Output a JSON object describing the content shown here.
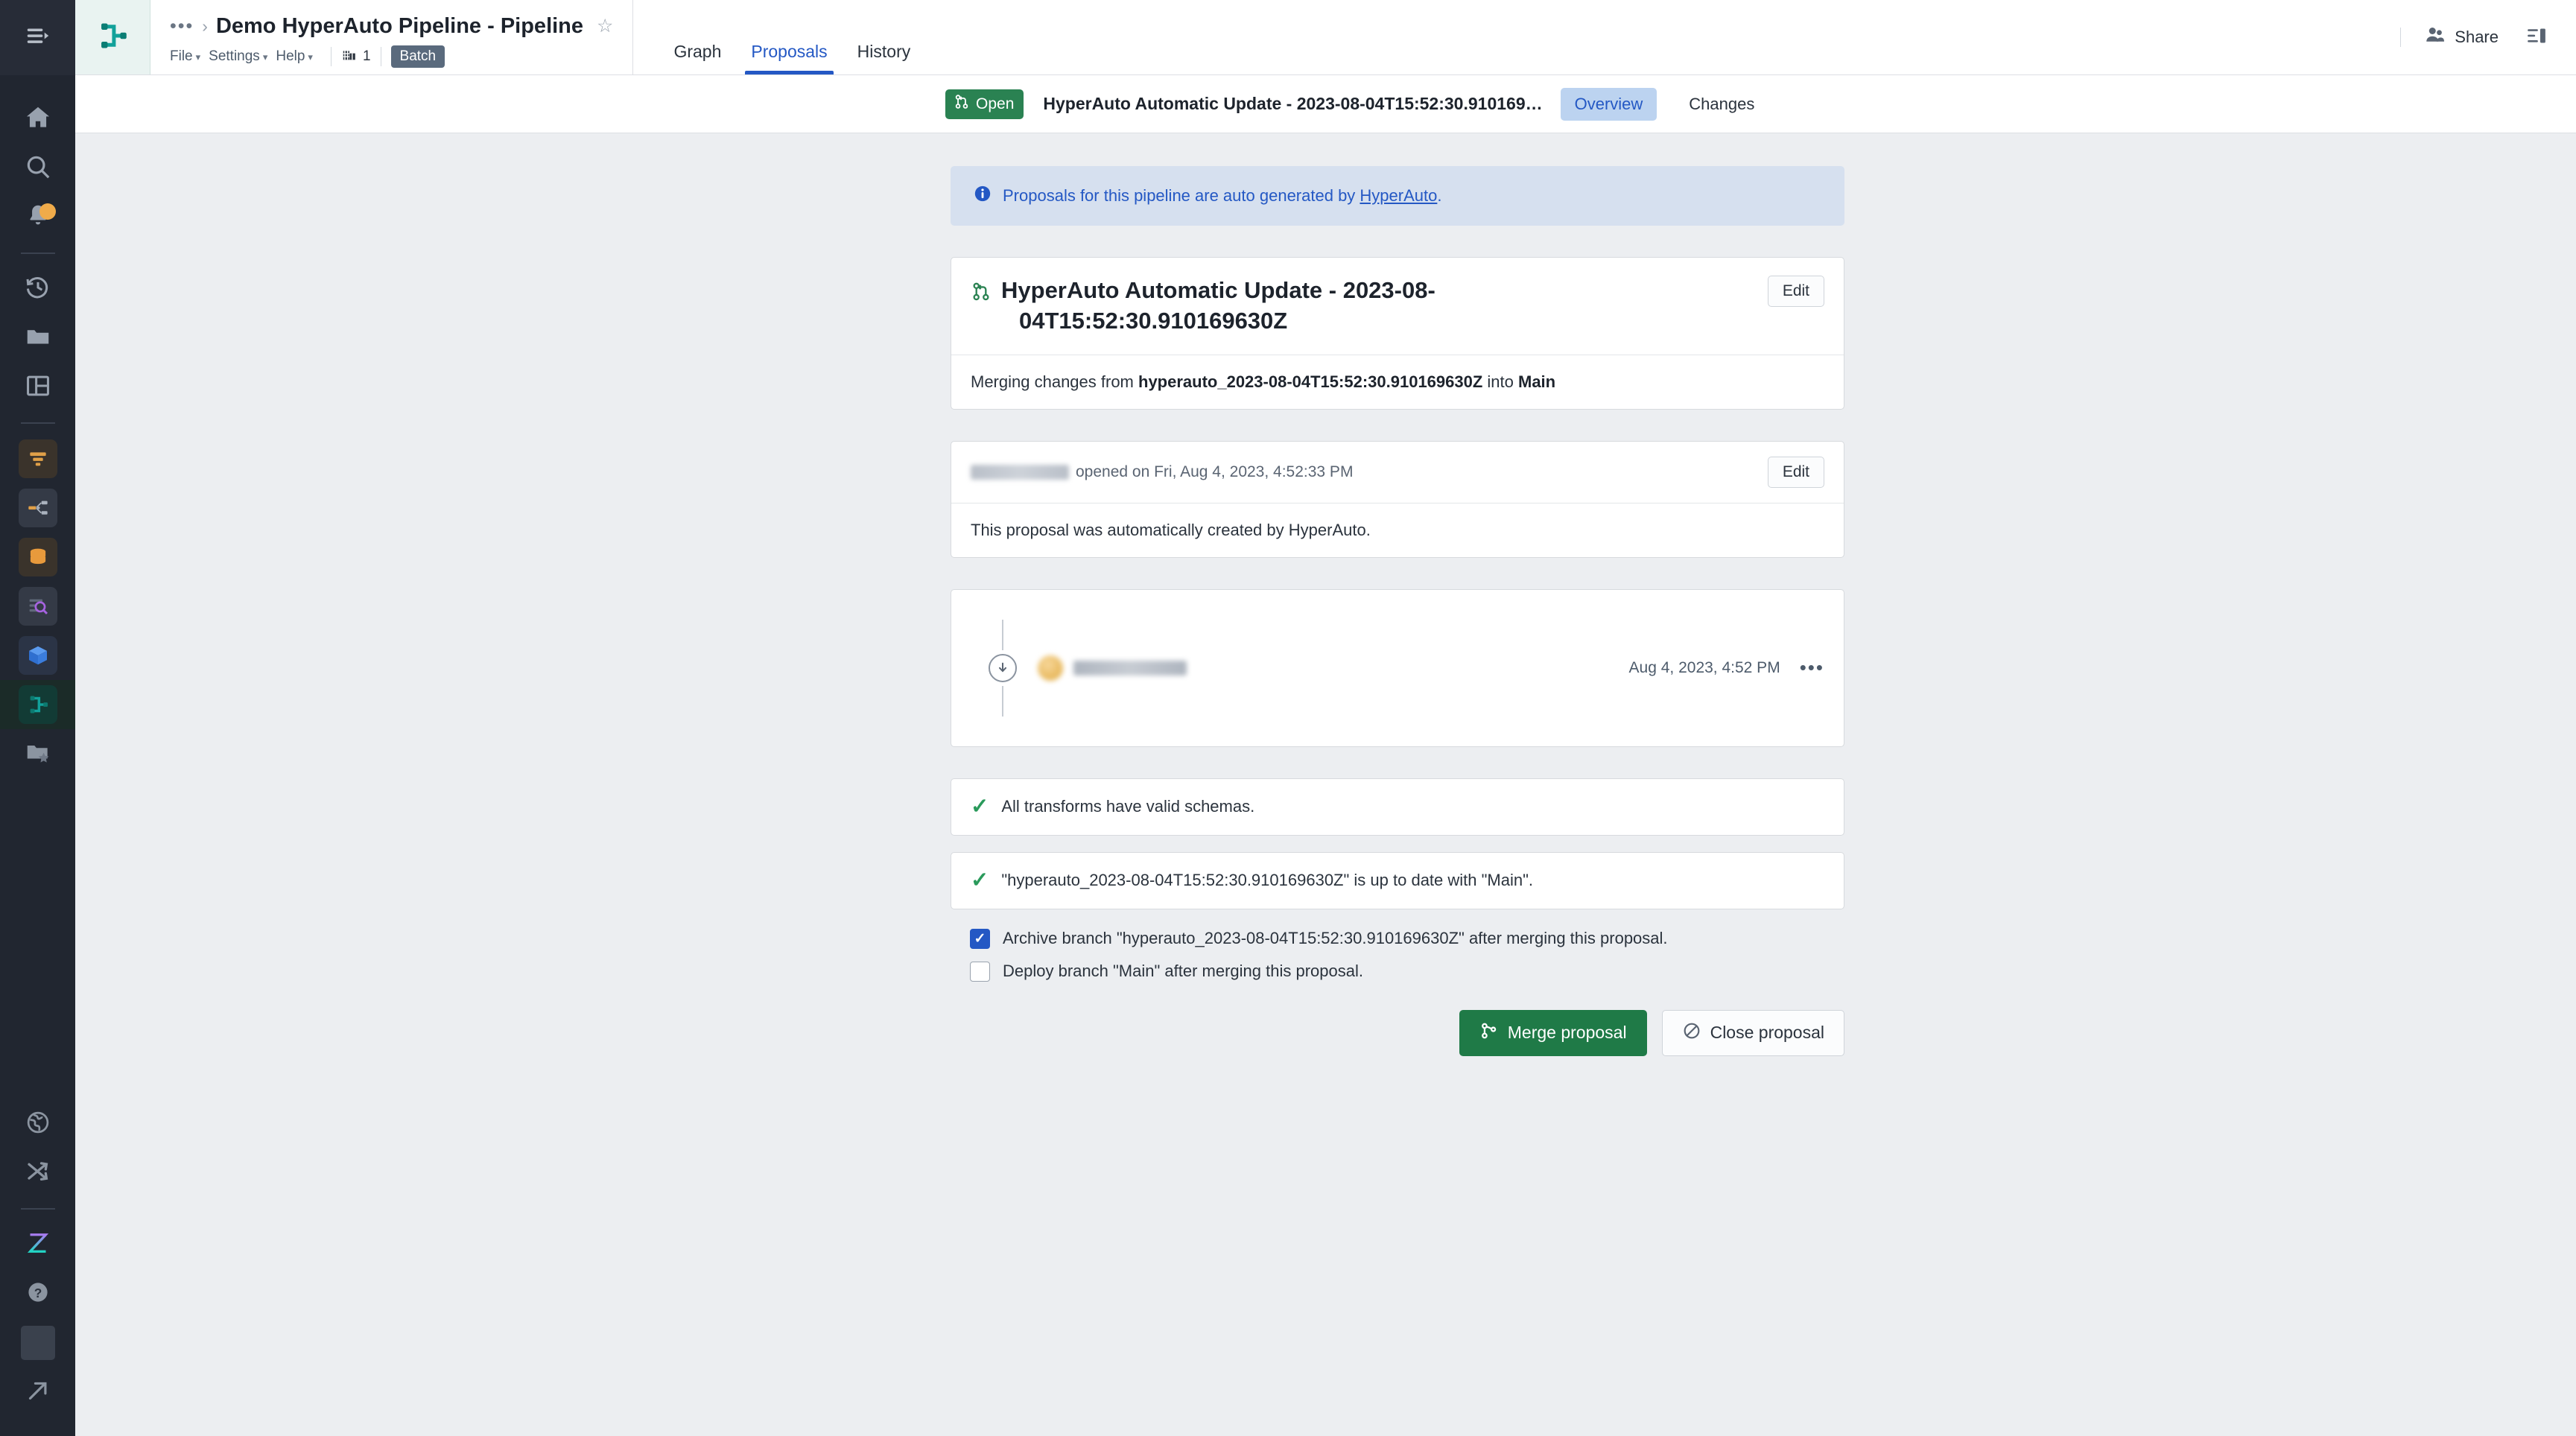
{
  "colors": {
    "rail_bg": "#212630",
    "accent_blue": "#2458c4",
    "open_green": "#2a8252",
    "merge_green": "#1f7a47",
    "check_green": "#2a9a5b",
    "banner_bg": "#d6e0ef",
    "seg_active_bg": "#bcd3f0",
    "batch_tag_bg": "#5a6a7d",
    "notification_dot": "#f0ab4a",
    "app_bg": "#eceef1"
  },
  "rail": {
    "toggle": {
      "name": "expand-sidebar-toggle",
      "icon": "hamburger-expand-icon"
    },
    "items_top": [
      {
        "icon": "home-icon",
        "name": "rail-home"
      },
      {
        "icon": "search-icon",
        "name": "rail-search"
      },
      {
        "icon": "bell-icon",
        "name": "rail-notifications",
        "badge": true
      }
    ],
    "items_files": [
      {
        "icon": "history-clock-icon",
        "name": "rail-recent"
      },
      {
        "icon": "folder-icon",
        "name": "rail-projects"
      },
      {
        "icon": "layout-panel-icon",
        "name": "rail-workspace"
      }
    ],
    "items_apps": [
      {
        "icon": "filter-funnel-icon",
        "name": "rail-app-contour",
        "color": "#e0a048"
      },
      {
        "icon": "graph-nodes-icon",
        "name": "rail-app-graph",
        "color": "#e0a048"
      },
      {
        "icon": "database-icon",
        "name": "rail-app-datasets",
        "color": "#e89a3c"
      },
      {
        "icon": "data-search-icon",
        "name": "rail-app-quiver",
        "color": "#a663e0"
      },
      {
        "icon": "cube-icon",
        "name": "rail-app-ontology",
        "color": "#3b7ddd"
      },
      {
        "icon": "pipeline-icon",
        "name": "rail-app-pipeline-builder",
        "color": "#12a19a",
        "active": true
      },
      {
        "icon": "folder-star-icon",
        "name": "rail-app-favorites",
        "color": "#8b94a0"
      }
    ],
    "items_bottom": [
      {
        "icon": "globe-icon",
        "name": "rail-globe"
      },
      {
        "icon": "shuffle-icon",
        "name": "rail-shuffle"
      },
      {
        "icon": "hourglass-gradient-icon",
        "name": "rail-aip"
      },
      {
        "icon": "help-circle-icon",
        "name": "rail-help"
      },
      {
        "icon": "user-avatar-icon",
        "name": "rail-account"
      },
      {
        "icon": "external-link-arrow-icon",
        "name": "rail-open-external"
      }
    ]
  },
  "header": {
    "logo_icon": "pipeline-builder-logo",
    "breadcrumb_dots": "•••",
    "breadcrumb_sep": "›",
    "title": "Demo HyperAuto Pipeline - Pipeline",
    "star_icon": "☆",
    "menus": [
      {
        "label": "File",
        "caret": "▾"
      },
      {
        "label": "Settings",
        "caret": "▾"
      },
      {
        "label": "Help",
        "caret": "▾"
      }
    ],
    "org_count": "1",
    "org_icon": "organization-icon",
    "batch_tag": "Batch",
    "tabs": [
      {
        "label": "Graph",
        "active": false
      },
      {
        "label": "Proposals",
        "active": true
      },
      {
        "label": "History",
        "active": false
      }
    ],
    "share_label": "Share",
    "share_icon": "people-icon",
    "panel_toggle_icon": "right-panel-toggle-icon"
  },
  "subbar": {
    "status_badge": "Open",
    "status_icon": "pull-request-icon",
    "title": "HyperAuto Automatic Update - 2023-08-04T15:52:30.910169…",
    "segments": [
      {
        "label": "Overview",
        "active": true
      },
      {
        "label": "Changes",
        "active": false
      }
    ]
  },
  "banner": {
    "icon": "info-circle-icon",
    "text_before": "Proposals for this pipeline are auto generated by ",
    "link": "HyperAuto",
    "text_after": "."
  },
  "proposal": {
    "icon": "pull-request-icon",
    "title_line1": "HyperAuto Automatic Update - 2023-08-",
    "title_line2": "04T15:52:30.910169630Z",
    "edit_label": "Edit",
    "merge_prefix": "Merging changes from ",
    "source_branch": "hyperauto_2023-08-04T15:52:30.910169630Z",
    "merge_middle": " into ",
    "target_branch": "Main"
  },
  "description": {
    "author_redacted": true,
    "meta_text": "opened on Fri, Aug 4, 2023, 4:52:33 PM",
    "edit_label": "Edit",
    "body": "This proposal was automatically created by HyperAuto."
  },
  "timeline": {
    "node_icon": "commit-download-icon",
    "avatar_redacted": true,
    "author_redacted": true,
    "timestamp": "Aug 4, 2023, 4:52 PM",
    "menu_icon": "more-options-icon",
    "menu_glyph": "•••"
  },
  "checks": [
    {
      "icon": "check-icon",
      "text": "All transforms have valid schemas."
    },
    {
      "icon": "check-icon",
      "text": "\"hyperauto_2023-08-04T15:52:30.910169630Z\" is up to date with \"Main\"."
    }
  ],
  "options": [
    {
      "checked": true,
      "label": "Archive branch \"hyperauto_2023-08-04T15:52:30.910169630Z\" after merging this proposal.",
      "name": "archive-branch-checkbox"
    },
    {
      "checked": false,
      "label": "Deploy branch \"Main\" after merging this proposal.",
      "name": "deploy-branch-checkbox"
    }
  ],
  "actions": {
    "merge_label": "Merge proposal",
    "merge_icon": "merge-icon",
    "close_label": "Close proposal",
    "close_icon": "no-entry-icon"
  }
}
